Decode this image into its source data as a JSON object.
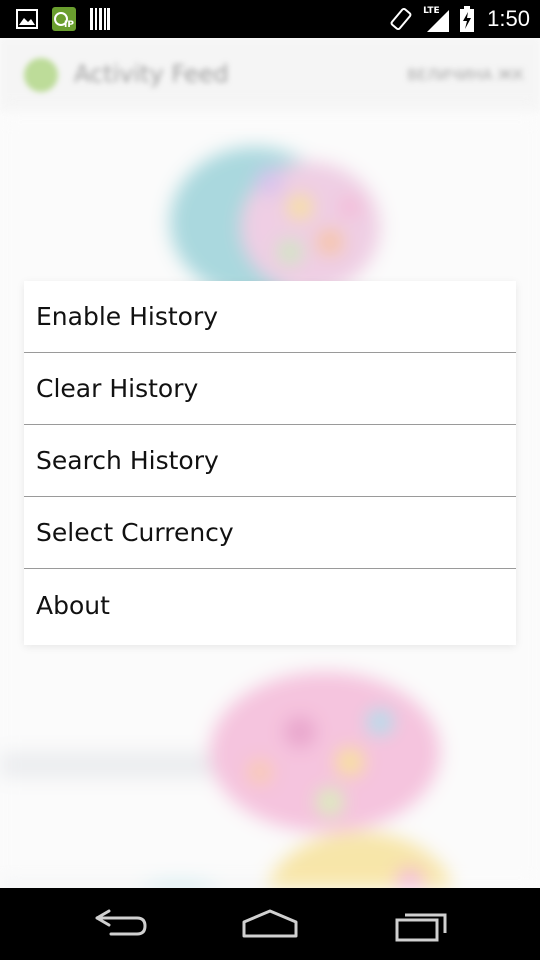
{
  "status_bar": {
    "time": "1:50",
    "network_label": "LTE",
    "left_icons": [
      "image-icon",
      "ip-app-icon",
      "barcode-icon"
    ],
    "right_icons": [
      "rotate-icon",
      "lte-signal-icon",
      "battery-charging-icon"
    ]
  },
  "background_app": {
    "title": "Activity Feed",
    "right_text": "ВЕЛИЧИНА ЖК"
  },
  "menu": {
    "items": [
      {
        "label": "Enable History"
      },
      {
        "label": "Clear History"
      },
      {
        "label": "Search History"
      },
      {
        "label": "Select Currency"
      },
      {
        "label": "About"
      }
    ]
  },
  "nav_bar": {
    "buttons": [
      "back-icon",
      "home-icon",
      "recent-apps-icon"
    ]
  },
  "colors": {
    "status_bar_bg": "#000000",
    "menu_bg": "#ffffff",
    "divider": "#9a9a9a",
    "text": "#111111"
  }
}
